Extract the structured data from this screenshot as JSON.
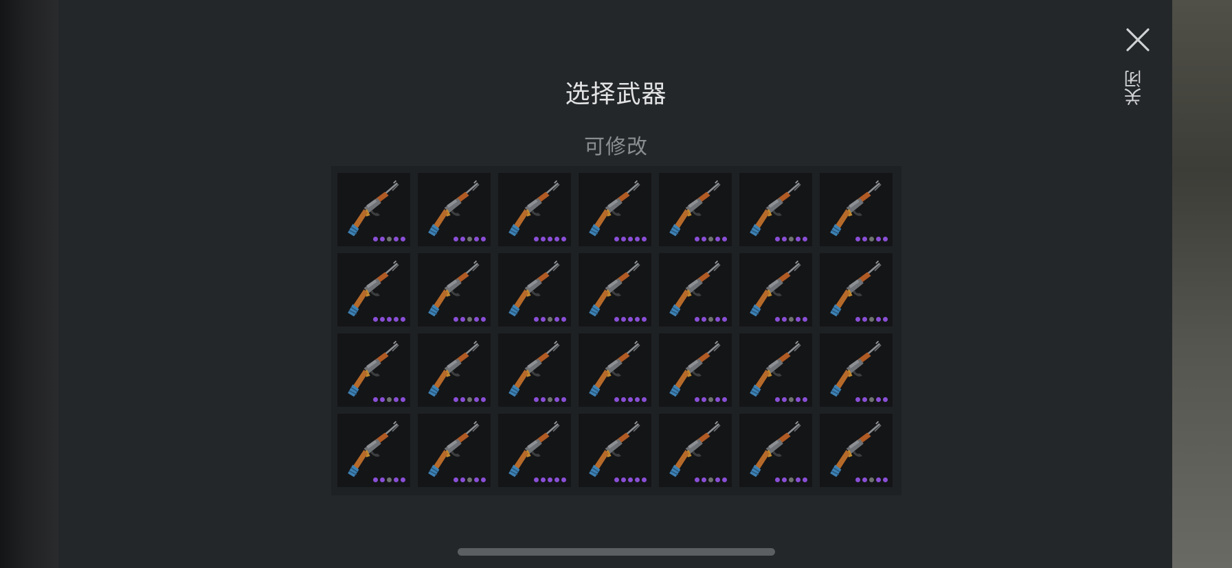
{
  "dialog": {
    "title": "选择武器",
    "subtitle": "可修改",
    "close_label": "关闭"
  },
  "icons": {
    "close": "close-icon",
    "weapon": "assault-rifle-icon"
  },
  "colors": {
    "panel_bg": "#24272a",
    "slot_bg": "#141517",
    "dot_active": "#8a4fd6",
    "dot_inactive": "#6e7370"
  },
  "weapons": [
    {
      "dots": [
        1,
        1,
        0,
        1,
        1
      ]
    },
    {
      "dots": [
        1,
        1,
        0,
        1,
        1
      ]
    },
    {
      "dots": [
        1,
        1,
        1,
        1,
        1
      ]
    },
    {
      "dots": [
        1,
        1,
        1,
        1,
        1
      ]
    },
    {
      "dots": [
        1,
        1,
        0,
        1,
        1
      ]
    },
    {
      "dots": [
        1,
        1,
        0,
        1,
        1
      ]
    },
    {
      "dots": [
        1,
        1,
        0,
        1,
        1
      ]
    },
    {
      "dots": [
        1,
        1,
        1,
        1,
        1
      ]
    },
    {
      "dots": [
        1,
        1,
        0,
        1,
        1
      ]
    },
    {
      "dots": [
        1,
        1,
        0,
        1,
        1
      ]
    },
    {
      "dots": [
        1,
        1,
        1,
        1,
        1
      ]
    },
    {
      "dots": [
        1,
        1,
        0,
        1,
        1
      ]
    },
    {
      "dots": [
        1,
        1,
        0,
        1,
        1
      ]
    },
    {
      "dots": [
        1,
        1,
        0,
        1,
        1
      ]
    },
    {
      "dots": [
        1,
        1,
        0,
        1,
        1
      ]
    },
    {
      "dots": [
        1,
        1,
        0,
        1,
        1
      ]
    },
    {
      "dots": [
        1,
        1,
        0,
        1,
        1
      ]
    },
    {
      "dots": [
        1,
        1,
        1,
        1,
        1
      ]
    },
    {
      "dots": [
        1,
        1,
        0,
        1,
        1
      ]
    },
    {
      "dots": [
        1,
        1,
        0,
        1,
        1
      ]
    },
    {
      "dots": [
        1,
        1,
        0,
        1,
        1
      ]
    },
    {
      "dots": [
        1,
        1,
        0,
        1,
        1
      ]
    },
    {
      "dots": [
        1,
        1,
        0,
        1,
        1
      ]
    },
    {
      "dots": [
        1,
        1,
        1,
        1,
        1
      ]
    },
    {
      "dots": [
        1,
        1,
        1,
        1,
        1
      ]
    },
    {
      "dots": [
        1,
        1,
        0,
        1,
        1
      ]
    },
    {
      "dots": [
        1,
        1,
        0,
        1,
        1
      ]
    },
    {
      "dots": [
        1,
        1,
        0,
        1,
        1
      ]
    }
  ]
}
